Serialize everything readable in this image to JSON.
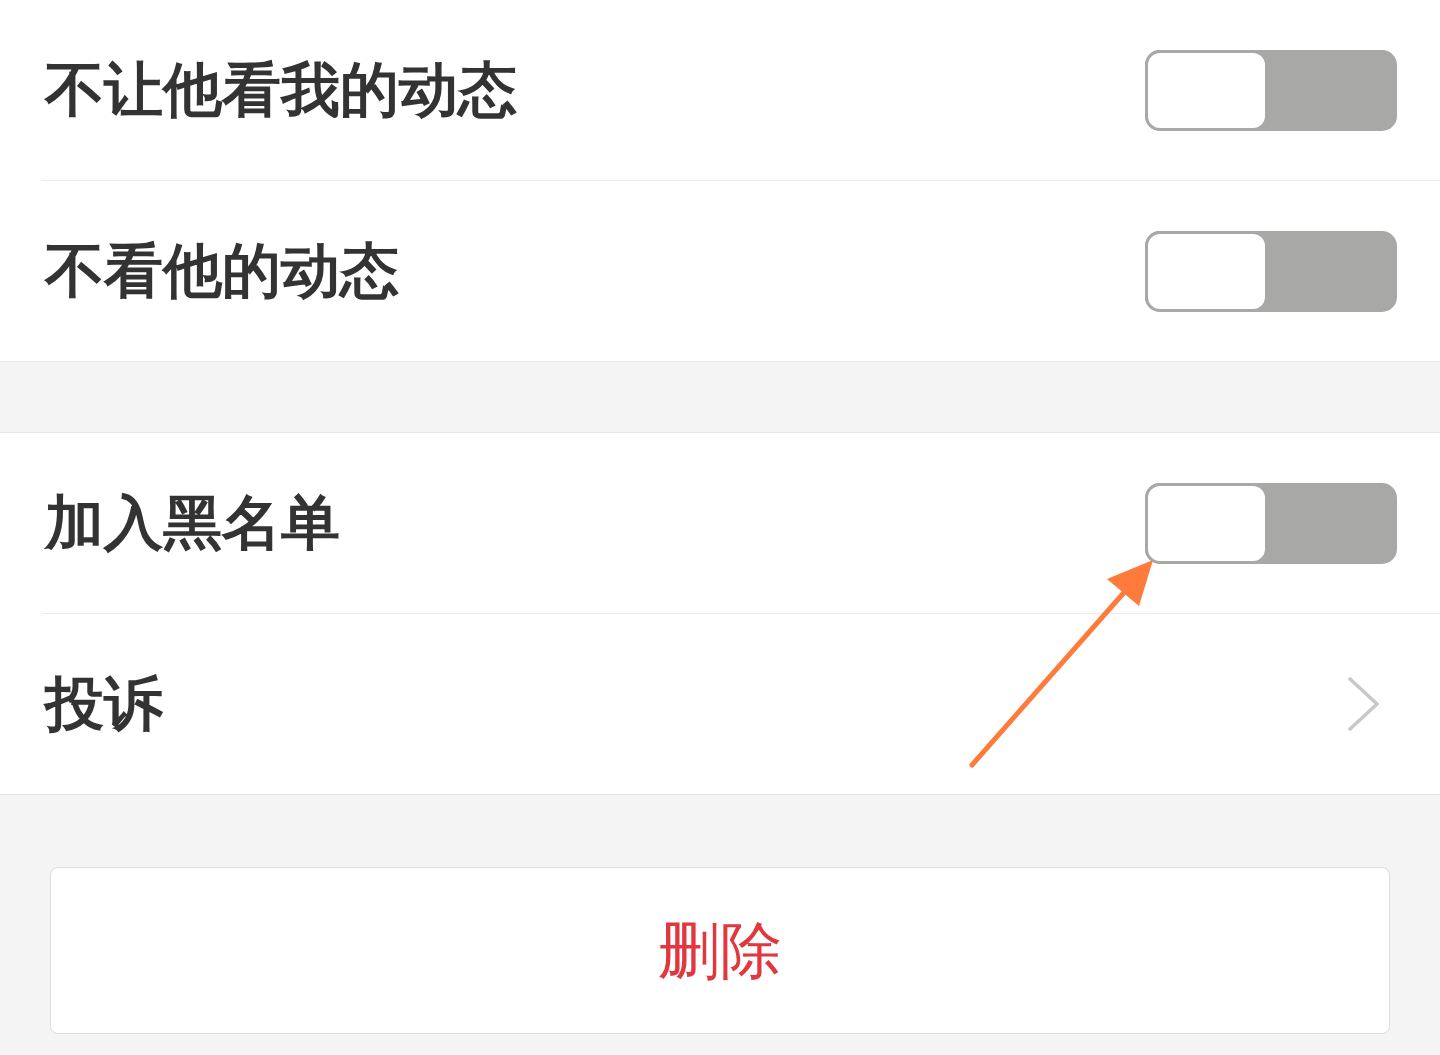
{
  "settings_groups": [
    {
      "rows": [
        {
          "kind": "toggle",
          "label": "不让他看我的动态",
          "on": false
        },
        {
          "kind": "toggle",
          "label": "不看他的动态",
          "on": false
        }
      ]
    },
    {
      "rows": [
        {
          "kind": "toggle",
          "label": "加入黑名单",
          "on": false
        },
        {
          "kind": "link",
          "label": "投诉"
        }
      ]
    }
  ],
  "delete_button": {
    "label": "删除"
  }
}
